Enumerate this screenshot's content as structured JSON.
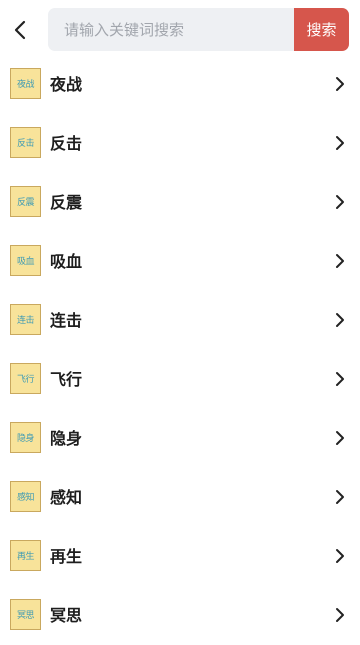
{
  "search": {
    "placeholder": "请输入关键词搜索",
    "value": "",
    "button_label": "搜索"
  },
  "icons": {
    "back": "chevron-left-icon",
    "row_arrow": "chevron-right-icon"
  },
  "colors": {
    "search_button": "#d6564c",
    "search_bg": "#eef0f3",
    "icon_bg": "#f8e39a",
    "icon_text": "#3f9bb4"
  },
  "skills": [
    {
      "icon_text": "夜战",
      "name": "夜战"
    },
    {
      "icon_text": "反击",
      "name": "反击"
    },
    {
      "icon_text": "反震",
      "name": "反震"
    },
    {
      "icon_text": "吸血",
      "name": "吸血"
    },
    {
      "icon_text": "连击",
      "name": "连击"
    },
    {
      "icon_text": "飞行",
      "name": "飞行"
    },
    {
      "icon_text": "隐身",
      "name": "隐身"
    },
    {
      "icon_text": "感知",
      "name": "感知"
    },
    {
      "icon_text": "再生",
      "name": "再生"
    },
    {
      "icon_text": "冥思",
      "name": "冥思"
    }
  ]
}
